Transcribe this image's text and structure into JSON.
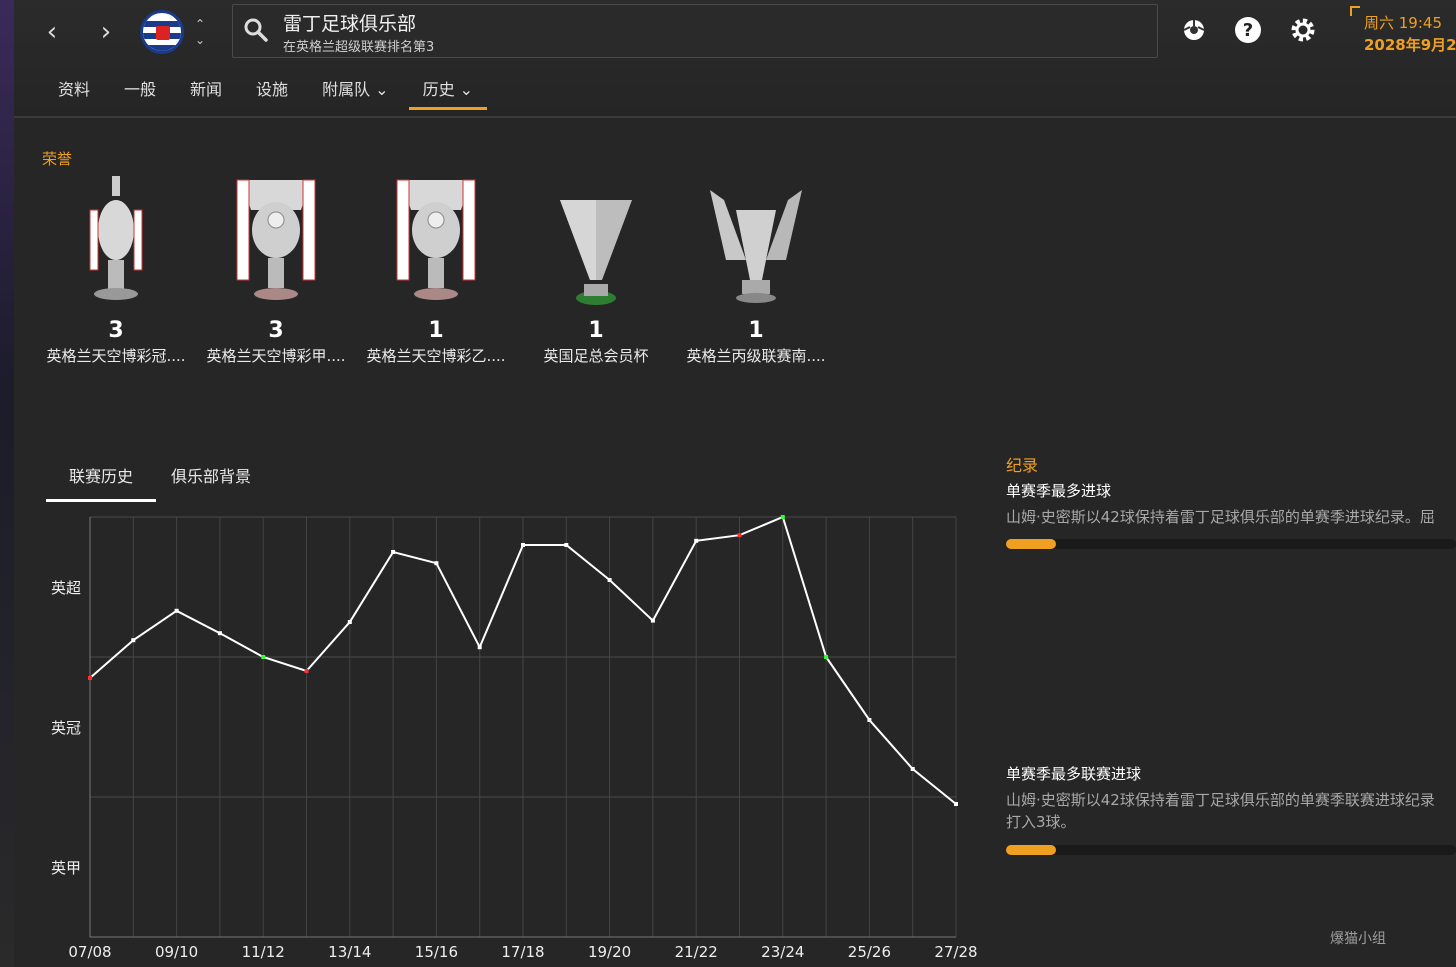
{
  "header": {
    "club_name": "雷丁足球俱乐部",
    "club_subtitle": "在英格兰超级联赛排名第3",
    "time": "周六 19:45",
    "date": "2028年9月2"
  },
  "tabs": [
    {
      "label": "资料"
    },
    {
      "label": "一般"
    },
    {
      "label": "新闻"
    },
    {
      "label": "设施"
    },
    {
      "label": "附属队 ⌄"
    },
    {
      "label": "历史 ⌄"
    }
  ],
  "honours": {
    "title": "荣誉",
    "items": [
      {
        "count": "3",
        "name": "英格兰天空博彩冠...."
      },
      {
        "count": "3",
        "name": "英格兰天空博彩甲...."
      },
      {
        "count": "1",
        "name": "英格兰天空博彩乙...."
      },
      {
        "count": "1",
        "name": "英国足总会员杯"
      },
      {
        "count": "1",
        "name": "英格兰丙级联赛南...."
      }
    ]
  },
  "subtabs": [
    {
      "label": "联赛历史"
    },
    {
      "label": "俱乐部背景"
    }
  ],
  "chart_data": {
    "type": "line",
    "y_categories": [
      "英超",
      "英冠",
      "英甲"
    ],
    "x_ticks": [
      "07/08",
      "09/10",
      "11/12",
      "13/14",
      "15/16",
      "17/18",
      "19/20",
      "21/22",
      "23/24",
      "25/26",
      "27/28"
    ],
    "seasons": [
      "07/08",
      "08/09",
      "09/10",
      "10/11",
      "11/12",
      "12/13",
      "13/14",
      "14/15",
      "15/16",
      "16/17",
      "17/18",
      "18/19",
      "19/20",
      "20/21",
      "21/22",
      "22/23",
      "23/24",
      "24/25",
      "25/26",
      "26/27",
      "27/28"
    ],
    "values": [
      1.85,
      2.12,
      2.33,
      2.17,
      2.0,
      1.9,
      2.25,
      2.75,
      2.67,
      2.07,
      2.8,
      2.8,
      2.55,
      2.26,
      2.83,
      2.87,
      3.0,
      2.0,
      1.55,
      1.2,
      0.95
    ],
    "markers": {
      "0": "#ff3030",
      "4": "#30ff30",
      "5": "#ff3030",
      "15": "#ff3030",
      "16": "#30ff30",
      "17": "#30ff30"
    },
    "ylim": [
      0,
      3
    ],
    "grid": true
  },
  "records": {
    "title": "纪录",
    "items": [
      {
        "head": "单赛季最多进球",
        "desc": "山姆·史密斯以42球保持着雷丁足球俱乐部的单赛季进球纪录。屈",
        "desc2": "",
        "fill": 0.11
      },
      {
        "head": "单赛季最多联赛进球",
        "desc": "山姆·史密斯以42球保持着雷丁足球俱乐部的单赛季联赛进球纪录",
        "desc2": "打入3球。",
        "fill": 0.11
      }
    ]
  },
  "watermark": "爆猫小组"
}
